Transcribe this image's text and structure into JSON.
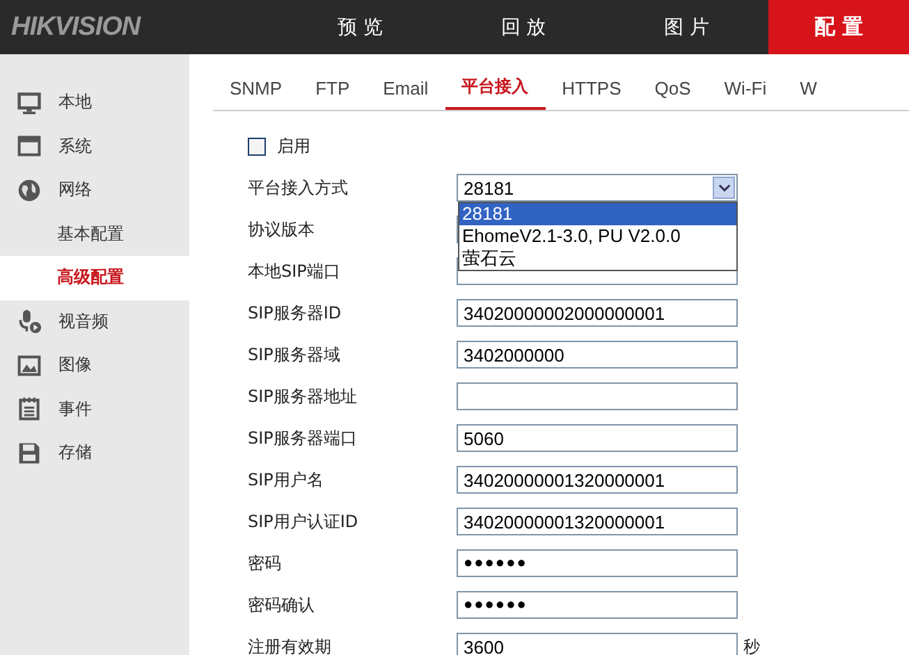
{
  "header": {
    "logo": "HIKVISION",
    "nav": [
      {
        "label": "预 览",
        "selected": false
      },
      {
        "label": "回 放",
        "selected": false
      },
      {
        "label": "图 片",
        "selected": false
      },
      {
        "label": "配 置",
        "selected": true
      }
    ]
  },
  "sidebar": {
    "items": [
      {
        "label": "本地",
        "selected": false
      },
      {
        "label": "系统",
        "selected": false
      },
      {
        "label": "网络",
        "selected": false,
        "children": [
          {
            "label": "基本配置",
            "selected": false
          },
          {
            "label": "高级配置",
            "selected": true
          }
        ]
      },
      {
        "label": "视音频",
        "selected": false
      },
      {
        "label": "图像",
        "selected": false
      },
      {
        "label": "事件",
        "selected": false
      },
      {
        "label": "存储",
        "selected": false
      }
    ]
  },
  "tabs": [
    {
      "label": "SNMP",
      "selected": false
    },
    {
      "label": "FTP",
      "selected": false
    },
    {
      "label": "Email",
      "selected": false
    },
    {
      "label": "平台接入",
      "selected": true
    },
    {
      "label": "HTTPS",
      "selected": false
    },
    {
      "label": "QoS",
      "selected": false
    },
    {
      "label": "Wi-Fi",
      "selected": false
    },
    {
      "label": "W",
      "selected": false
    }
  ],
  "form": [
    {
      "kind": "checkbox",
      "label": "启用",
      "checked": false
    },
    {
      "kind": "select",
      "label": "平台接入方式",
      "value": "28181",
      "expanded": true,
      "options": [
        {
          "label": "28181",
          "selected": true
        },
        {
          "label": "EhomeV2.1-3.0, PU V2.0.0",
          "selected": false
        },
        {
          "label": "萤石云",
          "selected": false
        }
      ]
    },
    {
      "kind": "text",
      "label": "协议版本"
    },
    {
      "kind": "text",
      "label": "本地SIP端口"
    },
    {
      "kind": "text",
      "label": "SIP服务器ID",
      "value": "34020000002000000001"
    },
    {
      "kind": "text",
      "label": "SIP服务器域",
      "value": "3402000000"
    },
    {
      "kind": "text",
      "label": "SIP服务器地址"
    },
    {
      "kind": "text",
      "label": "SIP服务器端口",
      "value": "5060"
    },
    {
      "kind": "text",
      "label": "SIP用户名",
      "value": "34020000001320000001"
    },
    {
      "kind": "text",
      "label": "SIP用户认证ID",
      "value": "34020000001320000001"
    },
    {
      "kind": "password",
      "label": "密码",
      "value": "●●●●●●"
    },
    {
      "kind": "password",
      "label": "密码确认",
      "value": "●●●●●●"
    },
    {
      "kind": "text",
      "label": "注册有效期",
      "value": "3600",
      "unit": "秒"
    }
  ]
}
